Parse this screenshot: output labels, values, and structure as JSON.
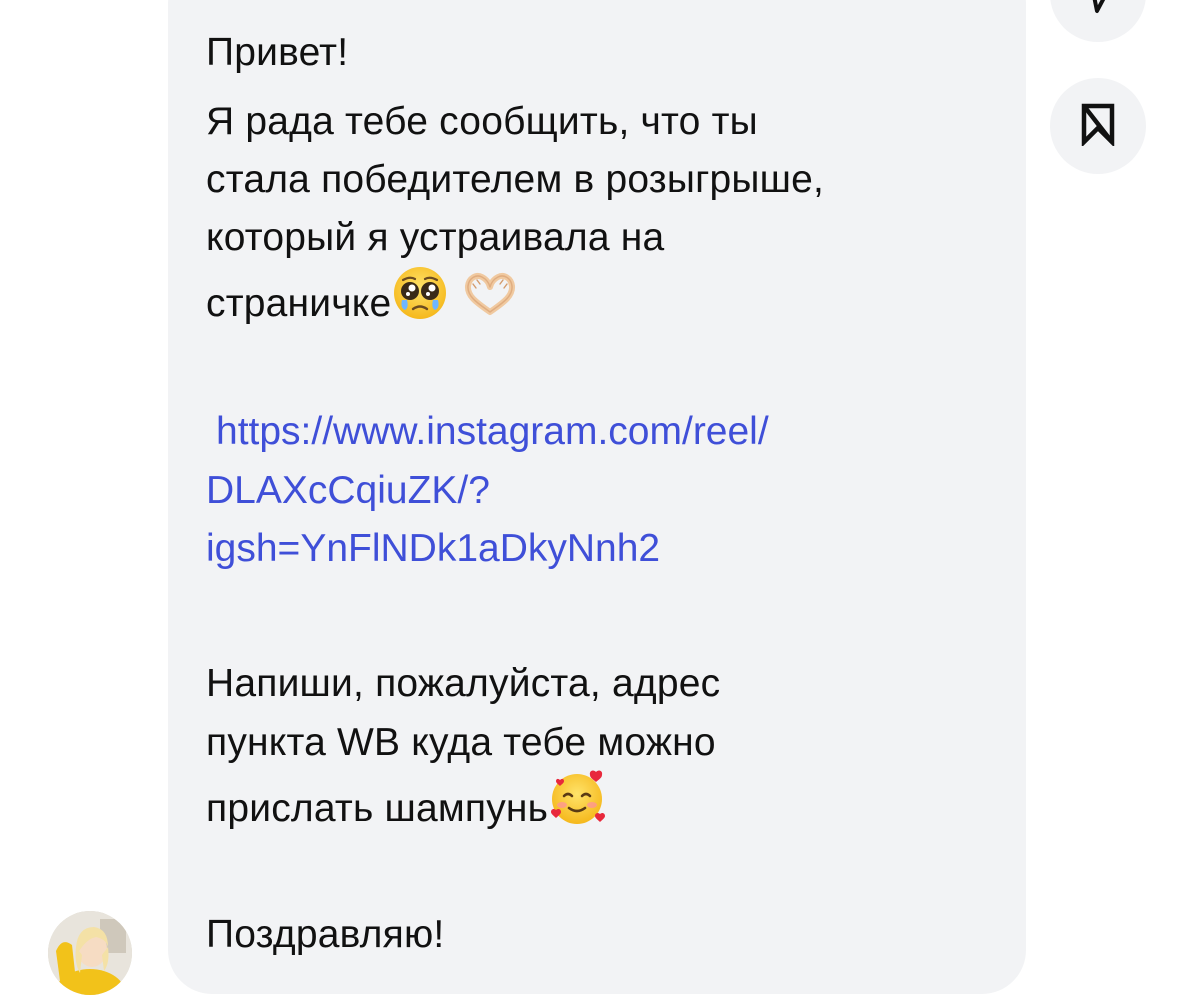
{
  "message": {
    "greeting": "Привет!",
    "line1": "Я рада тебе сообщить, что ты",
    "line2": "стала победителем в розыгрыше,",
    "line3": "который я устраивала на",
    "line4": "страничке",
    "link_line1": "https://www.instagram.com/reel/",
    "link_line2": "DLAXcCqiuZK/?",
    "link_line3": "igsh=YnFlNDk1aDkyNnh2",
    "line5": "Напиши, пожалуйста, адрес",
    "line6": "пункта WB куда тебе можно",
    "line7": "прислать шампунь",
    "closing": "Поздравляю!",
    "emoji_1": "pleading-face-emoji",
    "emoji_2": "heart-hands-emoji",
    "emoji_3": "smiling-face-with-hearts-emoji"
  },
  "actions": {
    "top_button_icon": "send-icon",
    "save_button_icon": "bookmark-icon"
  },
  "colors": {
    "bubble_bg": "#f2f3f5",
    "text": "#111111",
    "link": "#3f4fd8"
  }
}
